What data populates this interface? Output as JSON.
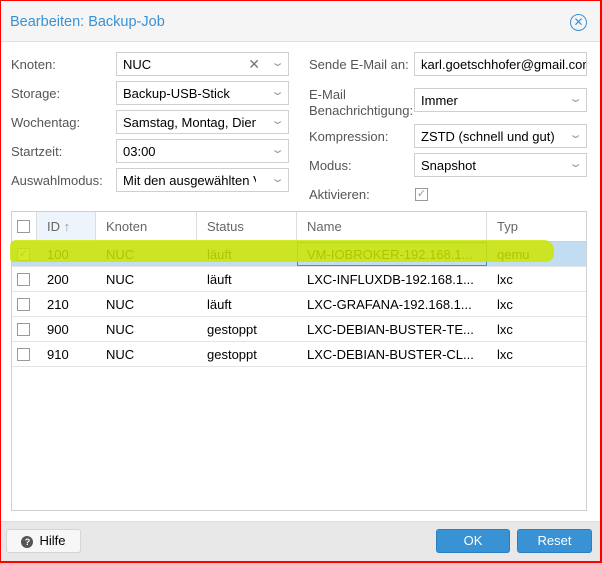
{
  "title": "Bearbeiten: Backup-Job",
  "form": {
    "knoten_label": "Knoten:",
    "knoten": "NUC",
    "storage_label": "Storage:",
    "storage": "Backup-USB-Stick",
    "wochentag_label": "Wochentag:",
    "wochentag": "Samstag, Montag, Dienstag",
    "startzeit_label": "Startzeit:",
    "startzeit": "03:00",
    "auswahl_label": "Auswahlmodus:",
    "auswahl": "Mit den ausgewählten VMs",
    "email_label": "Sende E-Mail an:",
    "email": "karl.goetschhofer@gmail.com",
    "notify_label1": "E-Mail",
    "notify_label2": "Benachrichtigung:",
    "notify": "Immer",
    "kompression_label": "Kompression:",
    "kompression": "ZSTD (schnell und gut)",
    "modus_label": "Modus:",
    "modus": "Snapshot",
    "aktivieren_label": "Aktivieren:",
    "aktivieren": true
  },
  "table": {
    "headers": [
      "ID",
      "Knoten",
      "Status",
      "Name",
      "Typ"
    ],
    "sort_icon": "arrow-up",
    "rows": [
      {
        "id": "100",
        "node": "NUC",
        "status": "läuft",
        "name": "VM-IOBROKER-192.168.1...",
        "type": "qemu",
        "selected": true
      },
      {
        "id": "200",
        "node": "NUC",
        "status": "läuft",
        "name": "LXC-INFLUXDB-192.168.1...",
        "type": "lxc",
        "selected": false
      },
      {
        "id": "210",
        "node": "NUC",
        "status": "läuft",
        "name": "LXC-GRAFANA-192.168.1...",
        "type": "lxc",
        "selected": false
      },
      {
        "id": "900",
        "node": "NUC",
        "status": "gestoppt",
        "name": "LXC-DEBIAN-BUSTER-TE...",
        "type": "lxc",
        "selected": false
      },
      {
        "id": "910",
        "node": "NUC",
        "status": "gestoppt",
        "name": "LXC-DEBIAN-BUSTER-CL...",
        "type": "lxc",
        "selected": false
      }
    ]
  },
  "footer": {
    "help": "Hilfe",
    "ok": "OK",
    "reset": "Reset"
  },
  "colors": {
    "accent": "#3892d4",
    "selected_row": "#c2ddf2",
    "highlight": "#cde600"
  }
}
